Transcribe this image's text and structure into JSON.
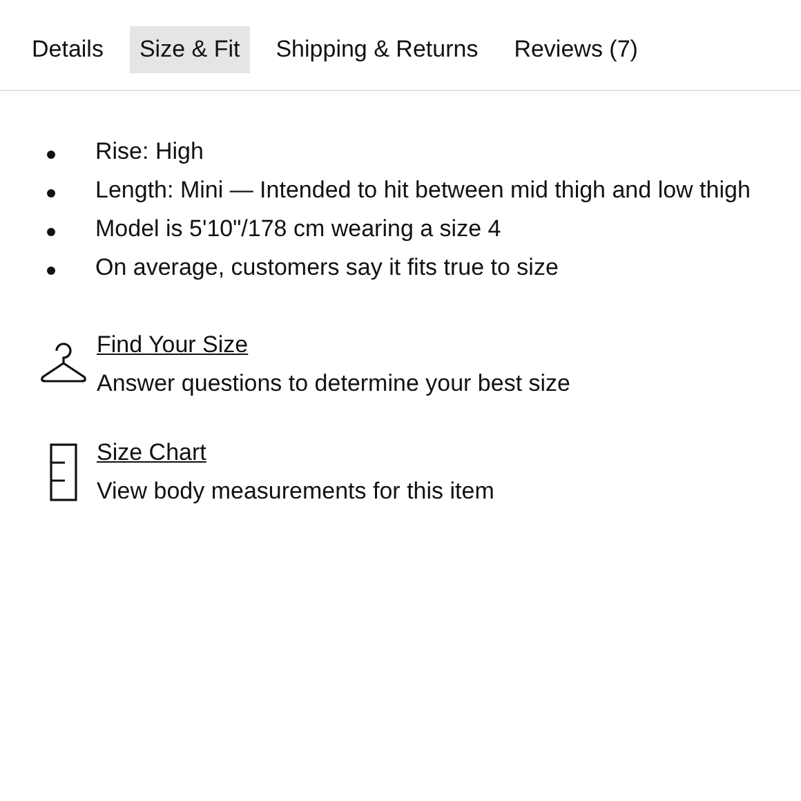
{
  "tabs": [
    {
      "label": "Details",
      "selected": false
    },
    {
      "label": "Size & Fit",
      "selected": true
    },
    {
      "label": "Shipping & Returns",
      "selected": false
    },
    {
      "label": "Reviews (7)",
      "selected": false
    }
  ],
  "bullets": [
    "Rise: High",
    "Length: Mini — Intended to hit between mid thigh and low thigh",
    "Model is 5'10\"/178 cm wearing a size 4",
    "On average, customers say it fits true to size"
  ],
  "links": [
    {
      "kind": "hanger",
      "title": "Find Your Size",
      "description": "Answer questions to determine your best size"
    },
    {
      "kind": "ruler",
      "title": "Size Chart",
      "description": "View body measurements for this item"
    }
  ]
}
